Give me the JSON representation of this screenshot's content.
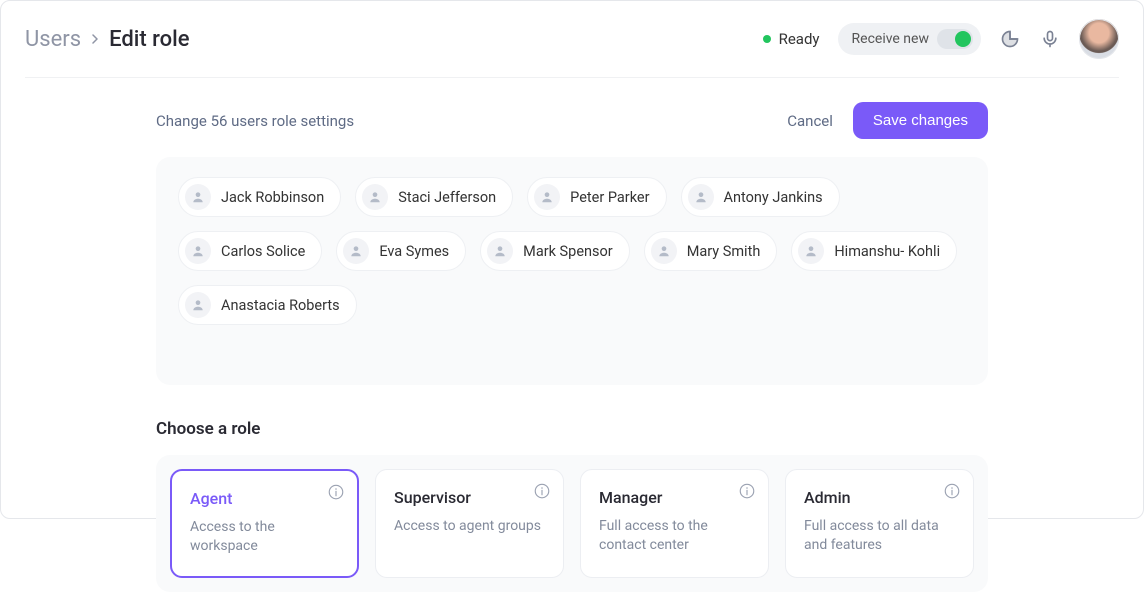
{
  "breadcrumb": {
    "root": "Users",
    "current": "Edit role"
  },
  "header": {
    "ready_label": "Ready",
    "toggle_label": "Receive new",
    "toggle_on": true
  },
  "actions": {
    "change_line": "Change 56 users role settings",
    "cancel": "Cancel",
    "save": "Save changes"
  },
  "users": [
    {
      "name": "Jack Robbinson"
    },
    {
      "name": "Staci Jefferson"
    },
    {
      "name": "Peter Parker"
    },
    {
      "name": "Antony Jankins"
    },
    {
      "name": "Carlos Solice"
    },
    {
      "name": "Eva Symes"
    },
    {
      "name": "Mark Spensor"
    },
    {
      "name": "Mary Smith"
    },
    {
      "name": "Himanshu- Kohli"
    },
    {
      "name": "Anastacia Roberts"
    }
  ],
  "roles": {
    "heading": "Choose a role",
    "options": [
      {
        "title": "Agent",
        "desc": "Access to the workspace",
        "selected": true
      },
      {
        "title": "Supervisor",
        "desc": "Access to agent groups",
        "selected": false
      },
      {
        "title": "Manager",
        "desc": "Full access to the contact center",
        "selected": false
      },
      {
        "title": "Admin",
        "desc": "Full access to all data and features",
        "selected": false
      }
    ]
  }
}
